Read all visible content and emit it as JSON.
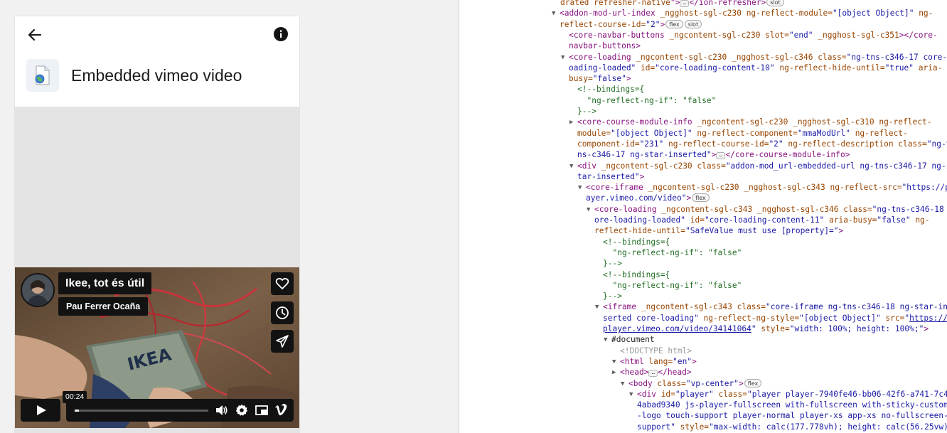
{
  "app": {
    "page_title": "Embedded vimeo video",
    "toolbar": {
      "back_icon": "arrow-left-icon",
      "info_icon": "info-circle-icon"
    },
    "module_icon": "url-module-icon"
  },
  "video": {
    "title": "Ikee, tot és útil",
    "byline": "Pau Ferrer Ocaña",
    "time_tooltip": "00:24",
    "progress": 0.03,
    "side_buttons": [
      "heart-icon",
      "clock-icon",
      "paper-plane-icon"
    ],
    "control_icons": [
      "play-icon",
      "volume-icon",
      "gear-icon",
      "picture-in-picture-icon",
      "vimeo-logo-icon"
    ]
  },
  "devtools": {
    "lines": [
      [
        {
          "t": "drated refresher-native",
          "c": "attr"
        },
        {
          "t": "\">",
          "c": "tag"
        },
        {
          "e": "ellipsis"
        },
        {
          "t": "</ion-refresher>",
          "c": "tag"
        },
        {
          "b": "slot"
        }
      ],
      [
        {
          "t": "<addon-mod-url-index ",
          "c": "tag"
        },
        {
          "t": "_ngghost-sgl-c230 ng-reflect-module=",
          "c": "attr"
        },
        {
          "t": "\"[object Object]\"",
          "c": "val"
        },
        {
          "t": " ng-",
          "c": "attr"
        }
      ],
      [
        {
          "t": "reflect-course-id=",
          "c": "attr"
        },
        {
          "t": "\"2\"",
          "c": "val"
        },
        {
          "t": ">",
          "c": "tag"
        },
        {
          "b": "flex"
        },
        {
          "b": "slot"
        }
      ],
      [
        {
          "t": "<core-navbar-buttons ",
          "c": "tag"
        },
        {
          "t": "_ngcontent-sgl-c230 slot=",
          "c": "attr"
        },
        {
          "t": "\"end\"",
          "c": "val"
        },
        {
          "t": " _ngghost-sgl-c351",
          "c": "attr"
        },
        {
          "t": "></core-",
          "c": "tag"
        }
      ],
      [
        {
          "t": "navbar-buttons>",
          "c": "tag"
        }
      ],
      [
        {
          "t": "<core-loading ",
          "c": "tag"
        },
        {
          "t": "_ngcontent-sgl-c230 _ngghost-sgl-c346 class=",
          "c": "attr"
        },
        {
          "t": "\"ng-tns-c346-17 core-l",
          "c": "val"
        }
      ],
      [
        {
          "t": "oading-loaded\"",
          "c": "val"
        },
        {
          "t": " id=",
          "c": "attr"
        },
        {
          "t": "\"core-loading-content-10\"",
          "c": "val"
        },
        {
          "t": " ng-reflect-hide-until=",
          "c": "attr"
        },
        {
          "t": "\"true\"",
          "c": "val"
        },
        {
          "t": " aria-",
          "c": "attr"
        }
      ],
      [
        {
          "t": "busy=",
          "c": "attr"
        },
        {
          "t": "\"false\"",
          "c": "val"
        },
        {
          "t": ">",
          "c": "tag"
        }
      ],
      [
        {
          "t": "<!--bindings={",
          "c": "comment"
        }
      ],
      [
        {
          "t": "  \"ng-reflect-ng-if\": \"false\"",
          "c": "comment"
        }
      ],
      [
        {
          "t": "}-->",
          "c": "comment"
        }
      ],
      [
        {
          "t": "<core-course-module-info ",
          "c": "tag"
        },
        {
          "t": "_ngcontent-sgl-c230 _ngghost-sgl-c310 ng-reflect-",
          "c": "attr"
        }
      ],
      [
        {
          "t": "module=",
          "c": "attr"
        },
        {
          "t": "\"[object Object]\"",
          "c": "val"
        },
        {
          "t": " ng-reflect-component=",
          "c": "attr"
        },
        {
          "t": "\"mmaModUrl\"",
          "c": "val"
        },
        {
          "t": " ng-reflect-",
          "c": "attr"
        }
      ],
      [
        {
          "t": "component-id=",
          "c": "attr"
        },
        {
          "t": "\"231\"",
          "c": "val"
        },
        {
          "t": " ng-reflect-course-id=",
          "c": "attr"
        },
        {
          "t": "\"2\"",
          "c": "val"
        },
        {
          "t": " ng-reflect-description class=",
          "c": "attr"
        },
        {
          "t": "\"ng-t",
          "c": "val"
        }
      ],
      [
        {
          "t": "ns-c346-17 ng-star-inserted\"",
          "c": "val"
        },
        {
          "t": ">",
          "c": "tag"
        },
        {
          "e": "ellipsis"
        },
        {
          "t": "</core-course-module-info>",
          "c": "tag"
        }
      ],
      [
        {
          "t": "<div ",
          "c": "tag"
        },
        {
          "t": "_ngcontent-sgl-c230 class=",
          "c": "attr"
        },
        {
          "t": "\"addon-mod_url-embedded-url ng-tns-c346-17 ng-s",
          "c": "val"
        }
      ],
      [
        {
          "t": "tar-inserted\"",
          "c": "val"
        },
        {
          "t": ">",
          "c": "tag"
        }
      ],
      [
        {
          "t": "<core-iframe ",
          "c": "tag"
        },
        {
          "t": "_ngcontent-sgl-c230 _ngghost-sgl-c343 ng-reflect-src=",
          "c": "attr"
        },
        {
          "t": "\"https://pl",
          "c": "val"
        }
      ],
      [
        {
          "t": "ayer.vimeo.com/video\"",
          "c": "val"
        },
        {
          "t": ">",
          "c": "tag"
        },
        {
          "b": "flex"
        }
      ],
      [
        {
          "t": "<core-loading ",
          "c": "tag"
        },
        {
          "t": "_ngcontent-sgl-c343 _ngghost-sgl-c346 class=",
          "c": "attr"
        },
        {
          "t": "\"ng-tns-c346-18 c",
          "c": "val"
        }
      ],
      [
        {
          "t": "ore-loading-loaded\"",
          "c": "val"
        },
        {
          "t": " id=",
          "c": "attr"
        },
        {
          "t": "\"core-loading-content-11\"",
          "c": "val"
        },
        {
          "t": " aria-busy=",
          "c": "attr"
        },
        {
          "t": "\"false\"",
          "c": "val"
        },
        {
          "t": " ng-",
          "c": "attr"
        }
      ],
      [
        {
          "t": "reflect-hide-until=",
          "c": "attr"
        },
        {
          "t": "\"SafeValue must use [property]=\"",
          "c": "val"
        },
        {
          "t": ">",
          "c": "tag"
        }
      ],
      [
        {
          "t": "<!--bindings={",
          "c": "comment"
        }
      ],
      [
        {
          "t": "  \"ng-reflect-ng-if\": \"false\"",
          "c": "comment"
        }
      ],
      [
        {
          "t": "}-->",
          "c": "comment"
        }
      ],
      [
        {
          "t": "<!--bindings={",
          "c": "comment"
        }
      ],
      [
        {
          "t": "  \"ng-reflect-ng-if\": \"false\"",
          "c": "comment"
        }
      ],
      [
        {
          "t": "}-->",
          "c": "comment"
        }
      ],
      [
        {
          "t": "<iframe ",
          "c": "tag"
        },
        {
          "t": "_ngcontent-sgl-c343 class=",
          "c": "attr"
        },
        {
          "t": "\"core-iframe ng-tns-c346-18 ng-star-in",
          "c": "val"
        }
      ],
      [
        {
          "t": "serted core-loading\"",
          "c": "val"
        },
        {
          "t": " ng-reflect-ng-style=",
          "c": "attr"
        },
        {
          "t": "\"[object Object]\"",
          "c": "val"
        },
        {
          "t": " src=",
          "c": "attr"
        },
        {
          "t": "\"",
          "c": "val"
        },
        {
          "t": "https://",
          "c": "link"
        }
      ],
      [
        {
          "t": "player.vimeo.com/video/34141064",
          "c": "link"
        },
        {
          "t": "\"",
          "c": "val"
        },
        {
          "t": " style=",
          "c": "attr"
        },
        {
          "t": "\"width: 100%; height: 100%;\"",
          "c": "val"
        },
        {
          "t": ">",
          "c": "tag"
        }
      ],
      [
        {
          "t": "#document",
          "c": "text"
        }
      ],
      [
        {
          "t": "<!DOCTYPE html>",
          "c": "doctype"
        }
      ],
      [
        {
          "t": "<html ",
          "c": "tag"
        },
        {
          "t": "lang=",
          "c": "attr"
        },
        {
          "t": "\"en\"",
          "c": "val"
        },
        {
          "t": ">",
          "c": "tag"
        }
      ],
      [
        {
          "t": "<head>",
          "c": "tag"
        },
        {
          "e": "ellipsis"
        },
        {
          "t": "</head>",
          "c": "tag"
        }
      ],
      [
        {
          "t": "<body ",
          "c": "tag"
        },
        {
          "t": "class=",
          "c": "attr"
        },
        {
          "t": "\"vp-center\"",
          "c": "val"
        },
        {
          "t": ">",
          "c": "tag"
        },
        {
          "b": "flex"
        }
      ],
      [
        {
          "t": "<div ",
          "c": "tag"
        },
        {
          "t": "id=",
          "c": "attr"
        },
        {
          "t": "\"player\"",
          "c": "val"
        },
        {
          "t": " class=",
          "c": "attr"
        },
        {
          "t": "\"player player-7940fe46-bb06-42f6-a741-7c4",
          "c": "val"
        }
      ],
      [
        {
          "t": "4abad9340 js-player-fullscreen with-fullscreen with-sticky-custom",
          "c": "val"
        }
      ],
      [
        {
          "t": "-logo touch-support player-normal player-xs app-xs no-fullscreen-",
          "c": "val"
        }
      ],
      [
        {
          "t": "support\"",
          "c": "val"
        },
        {
          "t": " style=",
          "c": "attr"
        },
        {
          "t": "\"max-width: calc(177.778vh); height: calc(56.25vw)",
          "c": "val"
        }
      ]
    ]
  }
}
